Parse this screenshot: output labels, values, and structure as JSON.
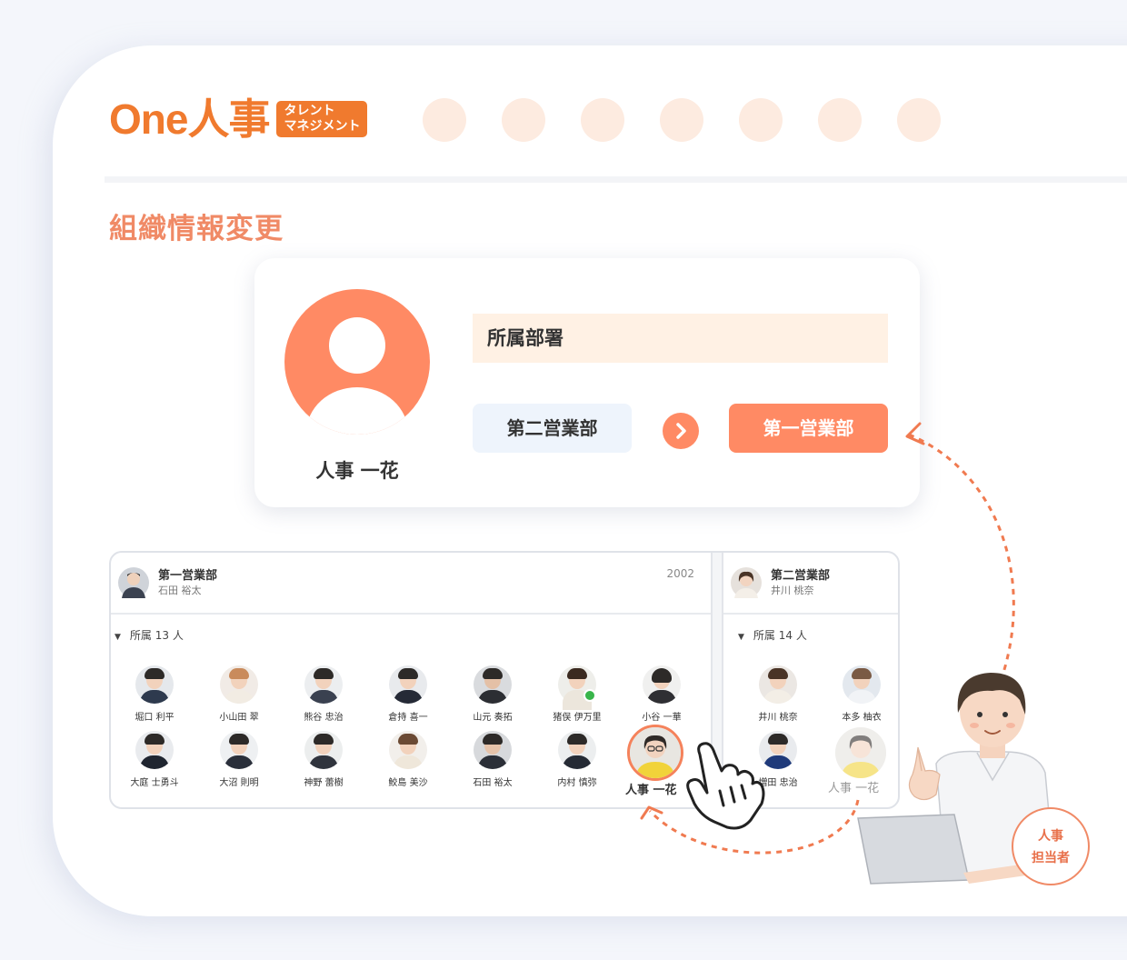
{
  "app": {
    "logo_text": "One人事",
    "logo_badge_line1": "タレント",
    "logo_badge_line2": "マネジメント",
    "nav_placeholder_count": 7
  },
  "page": {
    "title": "組織情報変更"
  },
  "change_card": {
    "employee_name": "人事 一花",
    "field_label": "所属部署",
    "from_department": "第二営業部",
    "to_department": "第一営業部"
  },
  "org_chart": {
    "departments": [
      {
        "name": "第一営業部",
        "leader": "石田 裕太",
        "year": "2002",
        "member_count_label": "所属 13 人",
        "members": [
          {
            "name": "堀口 利平"
          },
          {
            "name": "小山田 翠"
          },
          {
            "name": "熊谷 忠治"
          },
          {
            "name": "倉持 喜一"
          },
          {
            "name": "山元 奏拓"
          },
          {
            "name": "猪俣 伊万里"
          },
          {
            "name": "小谷 一華"
          },
          {
            "name": "大庭 士勇斗"
          },
          {
            "name": "大沼 則明"
          },
          {
            "name": "神野 蕾樹"
          },
          {
            "name": "鮫島 美沙"
          },
          {
            "name": "石田 裕太"
          },
          {
            "name": "内村 慎弥"
          }
        ],
        "moving_member": "人事 一花"
      },
      {
        "name": "第二営業部",
        "leader": "井川 桃奈",
        "member_count_label": "所属 14 人",
        "members": [
          {
            "name": "井川 桃奈"
          },
          {
            "name": "本多 柚衣"
          },
          {
            "name": "増田 忠治"
          }
        ],
        "ghost_member": "人事 一花"
      }
    ]
  },
  "role_bubble": {
    "line1": "人事",
    "line2": "担当者"
  },
  "colors": {
    "accent": "#f07a2e",
    "coral": "#ff8a64",
    "peach": "#fff1e4"
  }
}
